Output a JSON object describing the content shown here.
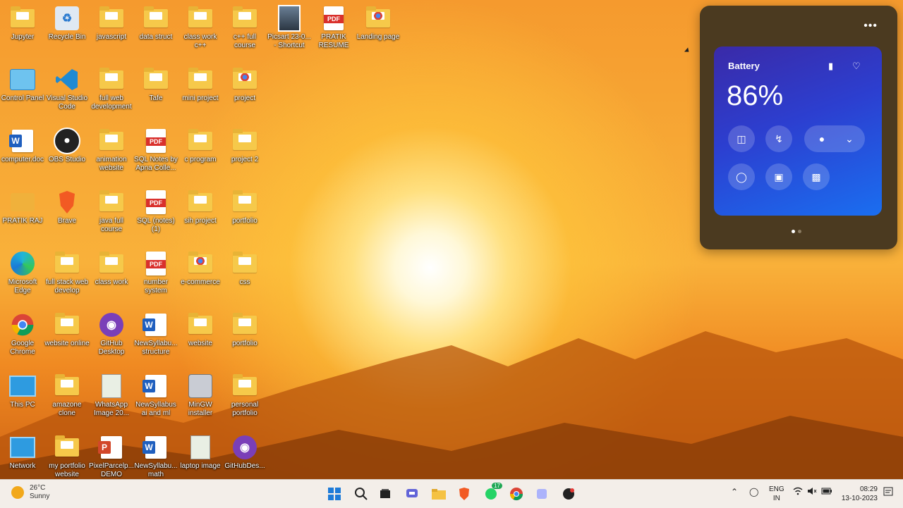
{
  "desktop_icons": [
    {
      "label": "Jupyter",
      "type": "folder",
      "col": 0,
      "row": 0
    },
    {
      "label": "Recycle Bin",
      "type": "recycle",
      "col": 1,
      "row": 0
    },
    {
      "label": "javascript",
      "type": "folder",
      "col": 2,
      "row": 0
    },
    {
      "label": "data struct",
      "type": "folder",
      "col": 3,
      "row": 0
    },
    {
      "label": "class work c++",
      "type": "folder",
      "col": 4,
      "row": 0
    },
    {
      "label": "c++ full course",
      "type": "folder",
      "col": 5,
      "row": 0
    },
    {
      "label": "Picsart 23-0... - Shortcut",
      "type": "photo",
      "col": 6,
      "row": 0
    },
    {
      "label": "PRATIK RESUME",
      "type": "pdf",
      "col": 7,
      "row": 0
    },
    {
      "label": "Landing page",
      "type": "chromefolder",
      "col": 8,
      "row": 0
    },
    {
      "label": "Control Panel",
      "type": "control",
      "col": 0,
      "row": 1
    },
    {
      "label": "Visual Studio Code",
      "type": "vscode",
      "col": 1,
      "row": 1
    },
    {
      "label": "full web development",
      "type": "folder",
      "col": 2,
      "row": 1
    },
    {
      "label": "Tafe",
      "type": "folder",
      "col": 3,
      "row": 1
    },
    {
      "label": "mini project",
      "type": "folder",
      "col": 4,
      "row": 1
    },
    {
      "label": "project",
      "type": "chromefolder",
      "col": 5,
      "row": 1
    },
    {
      "label": "computer.doc",
      "type": "word",
      "col": 0,
      "row": 2
    },
    {
      "label": "OBS Studio",
      "type": "obs",
      "col": 1,
      "row": 2
    },
    {
      "label": "animation website",
      "type": "folder",
      "col": 2,
      "row": 2
    },
    {
      "label": "SQL Notes by Apna Colle...",
      "type": "pdf",
      "col": 3,
      "row": 2
    },
    {
      "label": "c program",
      "type": "folder",
      "col": 4,
      "row": 2
    },
    {
      "label": "project 2",
      "type": "folder",
      "col": 5,
      "row": 2
    },
    {
      "label": "PRATIK RAJ",
      "type": "user",
      "col": 0,
      "row": 3
    },
    {
      "label": "Brave",
      "type": "brave",
      "col": 1,
      "row": 3
    },
    {
      "label": "java full course",
      "type": "folder",
      "col": 2,
      "row": 3
    },
    {
      "label": "SQL (notes) (1)",
      "type": "pdf",
      "col": 3,
      "row": 3
    },
    {
      "label": "sih project",
      "type": "folder",
      "col": 4,
      "row": 3
    },
    {
      "label": "portfolio",
      "type": "folder",
      "col": 5,
      "row": 3
    },
    {
      "label": "Microsoft Edge",
      "type": "edge",
      "col": 0,
      "row": 4
    },
    {
      "label": "full stack web develop",
      "type": "folder",
      "col": 1,
      "row": 4
    },
    {
      "label": "class work",
      "type": "folder",
      "col": 2,
      "row": 4
    },
    {
      "label": "number system",
      "type": "pdf",
      "col": 3,
      "row": 4
    },
    {
      "label": "e-commerce",
      "type": "chromefolder",
      "col": 4,
      "row": 4
    },
    {
      "label": "css",
      "type": "folder",
      "col": 5,
      "row": 4
    },
    {
      "label": "Google Chrome",
      "type": "chrome",
      "col": 0,
      "row": 5
    },
    {
      "label": "website online",
      "type": "folder",
      "col": 1,
      "row": 5
    },
    {
      "label": "GitHub Desktop",
      "type": "github",
      "col": 2,
      "row": 5
    },
    {
      "label": "NewSyllabu... structure",
      "type": "word",
      "col": 3,
      "row": 5
    },
    {
      "label": "website",
      "type": "folder",
      "col": 4,
      "row": 5
    },
    {
      "label": "portfolio",
      "type": "folder",
      "col": 5,
      "row": 5
    },
    {
      "label": "This PC",
      "type": "pc",
      "col": 0,
      "row": 6
    },
    {
      "label": "amazone clone",
      "type": "folder",
      "col": 1,
      "row": 6
    },
    {
      "label": "WhatsApp Image 20...",
      "type": "image",
      "col": 2,
      "row": 6
    },
    {
      "label": "NewSyllabus ai and ml",
      "type": "word",
      "col": 3,
      "row": 6
    },
    {
      "label": "MinGW installer",
      "type": "mingw",
      "col": 4,
      "row": 6
    },
    {
      "label": "personal portfolio",
      "type": "folder",
      "col": 5,
      "row": 6
    },
    {
      "label": "Network",
      "type": "network",
      "col": 0,
      "row": 7
    },
    {
      "label": "my portfolio website",
      "type": "folder",
      "col": 1,
      "row": 7
    },
    {
      "label": "PixelParcelp... DEMO",
      "type": "ppt",
      "col": 2,
      "row": 7
    },
    {
      "label": "NewSyllabu... math",
      "type": "word",
      "col": 3,
      "row": 7
    },
    {
      "label": "laptop image",
      "type": "image",
      "col": 4,
      "row": 7
    },
    {
      "label": "GitHubDes...",
      "type": "github",
      "col": 5,
      "row": 7
    }
  ],
  "widget": {
    "title": "Battery",
    "percent": "86%",
    "more": "•••"
  },
  "taskbar": {
    "temperature": "26°C",
    "condition": "Sunny",
    "lang_top": "ENG",
    "lang_bottom": "IN",
    "time": "08:29",
    "date": "13-10-2023",
    "whatsapp_badge": "17"
  },
  "colors": {
    "taskbar_bg": "#f3eee9",
    "widget_bg": "#4b3a20",
    "card_gradient_start": "#3a2aa8",
    "card_gradient_end": "#1a6ef0"
  }
}
